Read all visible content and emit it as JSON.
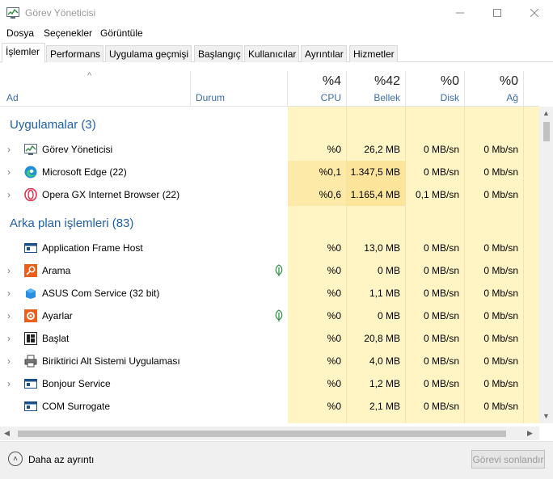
{
  "window": {
    "title": "Görev Yöneticisi"
  },
  "menu": [
    "Dosya",
    "Seçenekler",
    "Görüntüle"
  ],
  "tabs": [
    "İşlemler",
    "Performans",
    "Uygulama geçmişi",
    "Başlangıç",
    "Kullanıcılar",
    "Ayrıntılar",
    "Hizmetler"
  ],
  "active_tab": "İşlemler",
  "header": {
    "name": "Ad",
    "status": "Durum",
    "cpu": {
      "pct": "%4",
      "label": "CPU"
    },
    "memory": {
      "pct": "%42",
      "label": "Bellek"
    },
    "disk": {
      "pct": "%0",
      "label": "Disk"
    },
    "network": {
      "pct": "%0",
      "label": "Ağ"
    }
  },
  "groups": {
    "apps": {
      "title": "Uygulamalar (3)",
      "rows": [
        {
          "name": "Görev Yöneticisi",
          "cpu": "%0",
          "memory": "26,2 MB",
          "disk": "0 MB/sn",
          "network": "0 Mb/sn",
          "icon": "task-manager-icon"
        },
        {
          "name": "Microsoft Edge (22)",
          "cpu": "%0,1",
          "memory": "1.347,5 MB",
          "disk": "0 MB/sn",
          "network": "0 Mb/sn",
          "icon": "edge-icon"
        },
        {
          "name": "Opera GX Internet Browser (22)",
          "cpu": "%0,6",
          "memory": "1.165,4 MB",
          "disk": "0,1 MB/sn",
          "network": "0 Mb/sn",
          "icon": "opera-gx-icon"
        }
      ]
    },
    "background": {
      "title": "Arka plan işlemleri (83)",
      "rows": [
        {
          "name": "Application Frame Host",
          "cpu": "%0",
          "memory": "13,0 MB",
          "disk": "0 MB/sn",
          "network": "0 Mb/sn",
          "icon": "app-frame-icon"
        },
        {
          "name": "Arama",
          "cpu": "%0",
          "memory": "0 MB",
          "disk": "0 MB/sn",
          "network": "0 Mb/sn",
          "icon": "search-app-icon"
        },
        {
          "name": "ASUS Com Service (32 bit)",
          "cpu": "%0",
          "memory": "1,1 MB",
          "disk": "0 MB/sn",
          "network": "0 Mb/sn",
          "icon": "asus-service-icon"
        },
        {
          "name": "Ayarlar",
          "cpu": "%0",
          "memory": "0 MB",
          "disk": "0 MB/sn",
          "network": "0 Mb/sn",
          "icon": "settings-app-icon"
        },
        {
          "name": "Başlat",
          "cpu": "%0",
          "memory": "20,8 MB",
          "disk": "0 MB/sn",
          "network": "0 Mb/sn",
          "icon": "start-icon"
        },
        {
          "name": "Biriktirici Alt Sistemi Uygulaması",
          "cpu": "%0",
          "memory": "4,0 MB",
          "disk": "0 MB/sn",
          "network": "0 Mb/sn",
          "icon": "printer-icon"
        },
        {
          "name": "Bonjour Service",
          "cpu": "%0",
          "memory": "1,2 MB",
          "disk": "0 MB/sn",
          "network": "0 Mb/sn",
          "icon": "service-window-icon"
        },
        {
          "name": "COM Surrogate",
          "cpu": "%0",
          "memory": "2,1 MB",
          "disk": "0 MB/sn",
          "network": "0 Mb/sn",
          "icon": "service-window-icon"
        }
      ]
    }
  },
  "footer": {
    "fewer_details": "Daha az ayrıntı",
    "end_task": "Görevi sonlandır"
  }
}
